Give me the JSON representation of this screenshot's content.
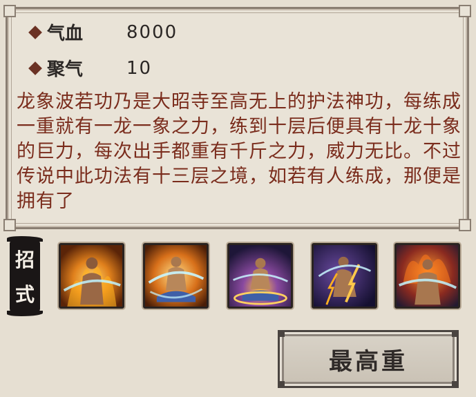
{
  "stats": [
    {
      "label": "气血",
      "value": "8000"
    },
    {
      "label": "聚气",
      "value": "10"
    }
  ],
  "description": "龙象波若功乃是大昭寺至高无上的护法神功，每练成一重就有一龙一象之力，练到十层后便具有十龙十象的巨力，每次出手都重有千斤之力，威力无比。不过传说中此功法有十三层之境，如若有人练成，那便是拥有了",
  "moves_label": [
    "招",
    "式"
  ],
  "skills": [
    {
      "icon": "monk-fire-icon",
      "bg": "#7a3a10"
    },
    {
      "icon": "monk-meditate-fire-icon",
      "bg": "#8a4a12"
    },
    {
      "icon": "monk-meditate-dark-icon",
      "bg": "#3a2a55"
    },
    {
      "icon": "monk-kneel-lightning-icon",
      "bg": "#2a2050"
    },
    {
      "icon": "monk-blaze-icon",
      "bg": "#402a30"
    }
  ],
  "action_button": "最高重",
  "colors": {
    "accent": "#6b3224",
    "text_red": "#7a2c1c",
    "panel": "#e9e3d7"
  }
}
